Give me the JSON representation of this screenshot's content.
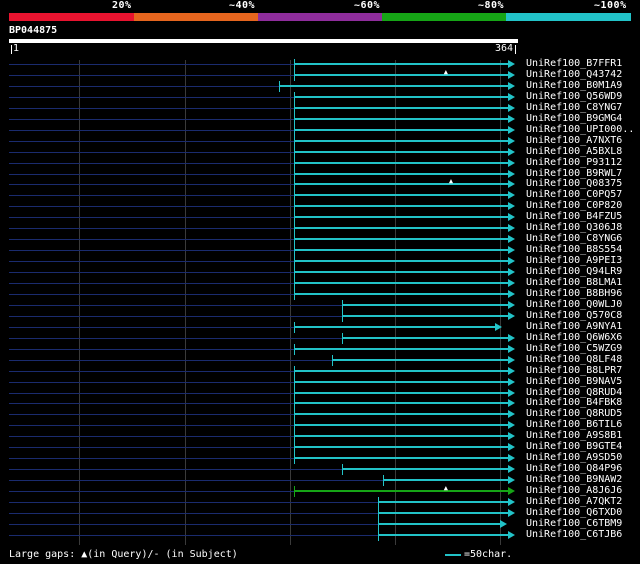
{
  "coverage_scale": {
    "labels": [
      "20%",
      "~40%",
      "~60%",
      "~80%",
      "~100%"
    ],
    "colors": [
      "#e8132f",
      "#e5651e",
      "#8f2d9c",
      "#16a516",
      "#22c3c8"
    ]
  },
  "query": {
    "name": "BP044875",
    "start": "1",
    "end": "364"
  },
  "hits": [
    {
      "label": "UniRef100_B7FFR1",
      "start": 0.56,
      "end": 0.99,
      "color": "#22c3c8",
      "gap": 0
    },
    {
      "label": "UniRef100_Q43742",
      "start": 0.56,
      "end": 0.99,
      "color": "#22c3c8",
      "gap": 0.86
    },
    {
      "label": "UniRef100_B0M1A9",
      "start": 0.53,
      "end": 0.99,
      "color": "#22c3c8",
      "gap": 0
    },
    {
      "label": "UniRef100_Q56WD9",
      "start": 0.56,
      "end": 0.99,
      "color": "#22c3c8",
      "gap": 0
    },
    {
      "label": "UniRef100_C8YNG7",
      "start": 0.56,
      "end": 0.99,
      "color": "#22c3c8",
      "gap": 0
    },
    {
      "label": "UniRef100_B9GMG4",
      "start": 0.56,
      "end": 0.99,
      "color": "#22c3c8",
      "gap": 0
    },
    {
      "label": "UniRef100_UPI000..",
      "start": 0.56,
      "end": 0.99,
      "color": "#22c3c8",
      "gap": 0
    },
    {
      "label": "UniRef100_A7NXT6",
      "start": 0.56,
      "end": 0.99,
      "color": "#22c3c8",
      "gap": 0
    },
    {
      "label": "UniRef100_A5BXL8",
      "start": 0.56,
      "end": 0.99,
      "color": "#22c3c8",
      "gap": 0
    },
    {
      "label": "UniRef100_P93112",
      "start": 0.56,
      "end": 0.99,
      "color": "#22c3c8",
      "gap": 0
    },
    {
      "label": "UniRef100_B9RWL7",
      "start": 0.56,
      "end": 0.99,
      "color": "#22c3c8",
      "gap": 0
    },
    {
      "label": "UniRef100_Q08375",
      "start": 0.56,
      "end": 0.99,
      "color": "#22c3c8",
      "gap": 0.87
    },
    {
      "label": "UniRef100_C0PQ57",
      "start": 0.56,
      "end": 0.99,
      "color": "#22c3c8",
      "gap": 0
    },
    {
      "label": "UniRef100_C0P820",
      "start": 0.56,
      "end": 0.99,
      "color": "#22c3c8",
      "gap": 0
    },
    {
      "label": "UniRef100_B4FZU5",
      "start": 0.56,
      "end": 0.99,
      "color": "#22c3c8",
      "gap": 0
    },
    {
      "label": "UniRef100_Q306J8",
      "start": 0.56,
      "end": 0.99,
      "color": "#22c3c8",
      "gap": 0
    },
    {
      "label": "UniRef100_C8YNG6",
      "start": 0.56,
      "end": 0.99,
      "color": "#22c3c8",
      "gap": 0
    },
    {
      "label": "UniRef100_B8S554",
      "start": 0.56,
      "end": 0.99,
      "color": "#22c3c8",
      "gap": 0
    },
    {
      "label": "UniRef100_A9PEI3",
      "start": 0.56,
      "end": 0.99,
      "color": "#22c3c8",
      "gap": 0
    },
    {
      "label": "UniRef100_Q94LR9",
      "start": 0.56,
      "end": 0.99,
      "color": "#22c3c8",
      "gap": 0
    },
    {
      "label": "UniRef100_B8LMA1",
      "start": 0.56,
      "end": 0.99,
      "color": "#22c3c8",
      "gap": 0
    },
    {
      "label": "UniRef100_B8BH96",
      "start": 0.56,
      "end": 0.99,
      "color": "#22c3c8",
      "gap": 0
    },
    {
      "label": "UniRef100_Q0WLJ0",
      "start": 0.655,
      "end": 0.99,
      "color": "#22c3c8",
      "gap": 0
    },
    {
      "label": "UniRef100_Q570C8",
      "start": 0.655,
      "end": 0.99,
      "color": "#22c3c8",
      "gap": 0
    },
    {
      "label": "UniRef100_A9NYA1",
      "start": 0.56,
      "end": 0.965,
      "color": "#22c3c8",
      "gap": 0
    },
    {
      "label": "UniRef100_Q6W6X6",
      "start": 0.655,
      "end": 0.99,
      "color": "#22c3c8",
      "gap": 0
    },
    {
      "label": "UniRef100_C5WZG9",
      "start": 0.56,
      "end": 0.99,
      "color": "#22c3c8",
      "gap": 0
    },
    {
      "label": "UniRef100_Q8LF48",
      "start": 0.635,
      "end": 0.99,
      "color": "#22c3c8",
      "gap": 0
    },
    {
      "label": "UniRef100_B8LPR7",
      "start": 0.56,
      "end": 0.99,
      "color": "#22c3c8",
      "gap": 0
    },
    {
      "label": "UniRef100_B9NAV5",
      "start": 0.56,
      "end": 0.99,
      "color": "#22c3c8",
      "gap": 0
    },
    {
      "label": "UniRef100_Q8RUD4",
      "start": 0.56,
      "end": 0.99,
      "color": "#22c3c8",
      "gap": 0
    },
    {
      "label": "UniRef100_B4FBK8",
      "start": 0.56,
      "end": 0.99,
      "color": "#22c3c8",
      "gap": 0
    },
    {
      "label": "UniRef100_Q8RUD5",
      "start": 0.56,
      "end": 0.99,
      "color": "#22c3c8",
      "gap": 0
    },
    {
      "label": "UniRef100_B6TIL6",
      "start": 0.56,
      "end": 0.99,
      "color": "#22c3c8",
      "gap": 0
    },
    {
      "label": "UniRef100_A9S8B1",
      "start": 0.56,
      "end": 0.99,
      "color": "#22c3c8",
      "gap": 0
    },
    {
      "label": "UniRef100_B9GTE4",
      "start": 0.56,
      "end": 0.99,
      "color": "#22c3c8",
      "gap": 0
    },
    {
      "label": "UniRef100_A9SD50",
      "start": 0.56,
      "end": 0.99,
      "color": "#22c3c8",
      "gap": 0
    },
    {
      "label": "UniRef100_Q84P96",
      "start": 0.655,
      "end": 0.99,
      "color": "#22c3c8",
      "gap": 0
    },
    {
      "label": "UniRef100_B9NAW2",
      "start": 0.735,
      "end": 0.99,
      "color": "#22c3c8",
      "gap": 0
    },
    {
      "label": "UniRef100_A8J6J6",
      "start": 0.56,
      "end": 0.99,
      "color": "#16a516",
      "gap": 0.86
    },
    {
      "label": "UniRef100_A7QKT2",
      "start": 0.725,
      "end": 0.99,
      "color": "#22c3c8",
      "gap": 0
    },
    {
      "label": "UniRef100_Q6TXD0",
      "start": 0.725,
      "end": 0.99,
      "color": "#22c3c8",
      "gap": 0
    },
    {
      "label": "UniRef100_C6TBM9",
      "start": 0.725,
      "end": 0.975,
      "color": "#22c3c8",
      "gap": 0
    },
    {
      "label": "UniRef100_C6TJB6",
      "start": 0.725,
      "end": 0.99,
      "color": "#22c3c8",
      "gap": 0
    }
  ],
  "legend": {
    "gaps_text": "Large gaps: ▲(in Query)/- (in Subject)",
    "scale_text": "=50char.",
    "scale_color": "#22c3c8"
  }
}
